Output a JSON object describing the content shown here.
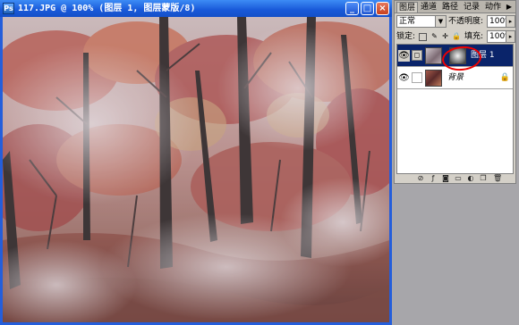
{
  "document": {
    "title": "117.JPG @ 100% (图层 1, 图层蒙版/8)",
    "app_icon": "photoshop-icon",
    "window_controls": [
      "minimize-icon",
      "maximize-icon",
      "close-icon"
    ],
    "colors": {
      "titlebar": "#1858d8",
      "close": "#c6401e"
    }
  },
  "layers_panel": {
    "tabs": [
      "图层",
      "通道",
      "路径",
      "记录",
      "动作"
    ],
    "active_tab": "图层",
    "blend_mode": "正常",
    "opacity_label": "不透明度:",
    "opacity_value": "100%",
    "lock_label": "锁定:",
    "fill_label": "填充:",
    "fill_value": "100%",
    "layers": [
      {
        "name": "图层 1",
        "selected": true,
        "visible": true,
        "has_mask": true
      },
      {
        "name": "背景",
        "selected": false,
        "visible": true,
        "locked": true
      }
    ],
    "bottom_icons": [
      "link-layers-icon",
      "layer-style-icon",
      "add-mask-icon",
      "new-set-icon",
      "adjustment-layer-icon",
      "new-layer-icon",
      "trash-icon"
    ],
    "highlight_color": "#e00000"
  }
}
